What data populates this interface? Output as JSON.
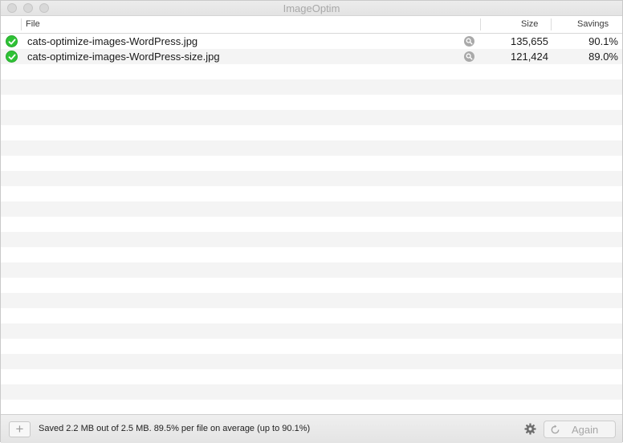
{
  "window": {
    "title": "ImageOptim"
  },
  "columns": {
    "file": "File",
    "size": "Size",
    "savings": "Savings"
  },
  "files": [
    {
      "name": "cats-optimize-images-WordPress.jpg",
      "size": "135,655",
      "savings": "90.1%",
      "status": "optimized"
    },
    {
      "name": "cats-optimize-images-WordPress-size.jpg",
      "size": "121,424",
      "savings": "89.0%",
      "status": "optimized"
    }
  ],
  "footer": {
    "add_label": "+",
    "status_text": "Saved 2.2 MB out of 2.5 MB. 89.5% per file on average (up to 90.1%)",
    "again_label": "Again"
  },
  "icons": {
    "status": "checkmark-circle-icon",
    "quicklook": "magnifier-icon",
    "settings": "gear-icon",
    "again": "reload-icon"
  },
  "colors": {
    "success": "#2ec235",
    "row_stripe": "#f4f4f4"
  }
}
